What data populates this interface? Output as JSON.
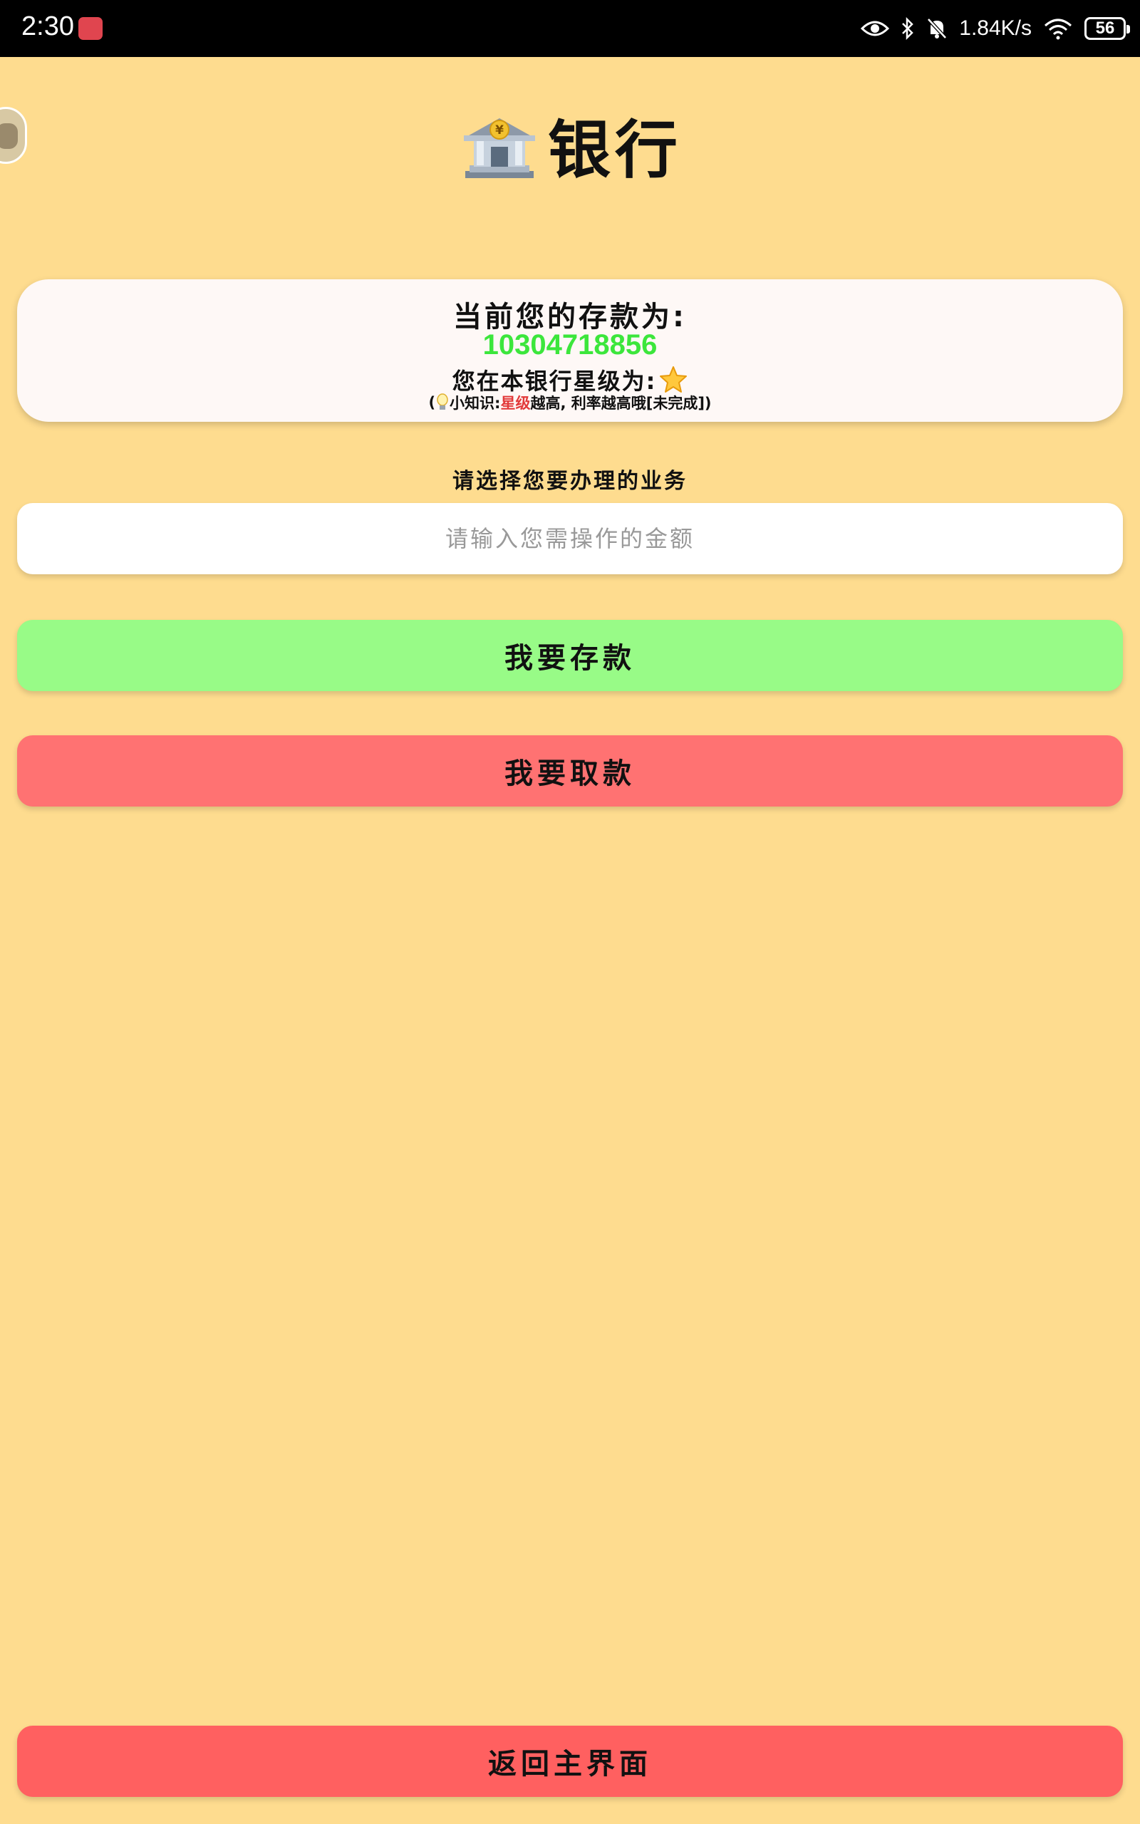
{
  "status_bar": {
    "time": "2:30",
    "speed": "1.84K/s",
    "battery": "56",
    "icons": [
      "app-notification-icon",
      "eye-icon",
      "bluetooth-icon",
      "bell-off-icon",
      "wifi-icon",
      "battery-icon"
    ]
  },
  "page": {
    "title": "银行",
    "title_icon": "bank-icon"
  },
  "account": {
    "deposit_label": "当前您的存款为:",
    "deposit_amount": "10304718856",
    "star_label": "您在本银行星级为:",
    "star_icon": "star-icon",
    "tip_prefix": "(",
    "tip_icon": "lightbulb-icon",
    "tip_label": "小知识:",
    "tip_highlight": "星级",
    "tip_rest": "越高, 利率越高哦[未完成])"
  },
  "form": {
    "choose_label": "请选择您要办理的业务",
    "amount_placeholder": "请输入您需操作的金额"
  },
  "buttons": {
    "deposit": "我要存款",
    "withdraw": "我要取款",
    "home": "返回主界面"
  },
  "colors": {
    "background": "#FEDC8F",
    "amount_green": "#3CE63C",
    "deposit_button": "#98FB87",
    "withdraw_button": "#FF7272",
    "home_button": "#FF6060",
    "tip_highlight": "#E23A3A"
  }
}
